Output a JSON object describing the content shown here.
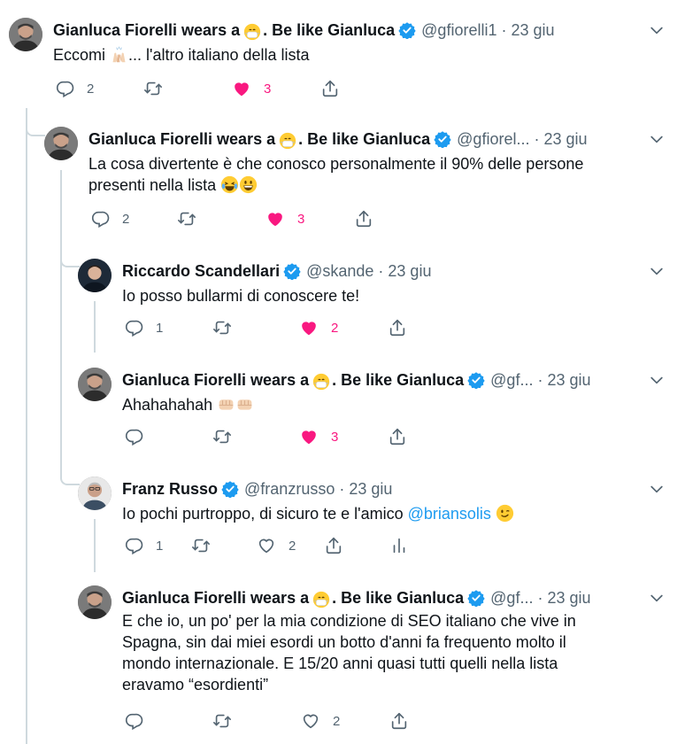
{
  "tweets": [
    {
      "name": "Gianluca Fiorelli wears a",
      "name_tail": ". Be like Gianluca",
      "handle": "@gfiorelli1",
      "date": "23 giu",
      "text_before": "Eccomi ",
      "text_after": "... l'altro italiano della lista",
      "replies": "2",
      "likes": "3",
      "liked": true
    },
    {
      "name": "Gianluca Fiorelli wears a",
      "name_tail": ". Be like Gianluca",
      "handle": "@gfiorel...",
      "date": "23 giu",
      "line1": "La cosa divertente è che conosco personalmente il 90% delle persone",
      "line2": "presenti nella lista",
      "replies": "2",
      "likes": "3",
      "liked": true
    },
    {
      "name": "Riccardo Scandellari",
      "handle": "@skande",
      "date": "23 giu",
      "text": "Io posso bullarmi di conoscere te!",
      "replies": "1",
      "likes": "2",
      "liked": true
    },
    {
      "name": "Gianluca Fiorelli wears a",
      "name_tail": ". Be like Gianluca",
      "handle": "@gf...",
      "date": "23 giu",
      "text": "Ahahahahah ",
      "likes": "3",
      "liked": true
    },
    {
      "name": "Franz Russo",
      "handle": "@franzrusso",
      "date": "23 giu",
      "text_before": "Io pochi purtroppo, di sicuro te e l'amico ",
      "mention": "@briansolis",
      "replies": "1",
      "likes": "2",
      "liked": false
    },
    {
      "name": "Gianluca Fiorelli wears a",
      "name_tail": ". Be like Gianluca",
      "handle": "@gf...",
      "date": "23 giu",
      "lines": [
        "E che io, un po' per la mia condizione di SEO italiano che vive in",
        "Spagna, sin dai miei esordi un botto d'anni fa frequento molto il",
        "mondo internazionale. E 15/20 anni quasi tutti quelli nella lista",
        "eravamo “esordienti”"
      ],
      "likes": "2",
      "liked": false
    }
  ],
  "colors": {
    "text": "#0f1419",
    "secondary": "#536471",
    "like": "#f91880",
    "verified": "#1d9bf0",
    "thread": "#cfd9de"
  }
}
